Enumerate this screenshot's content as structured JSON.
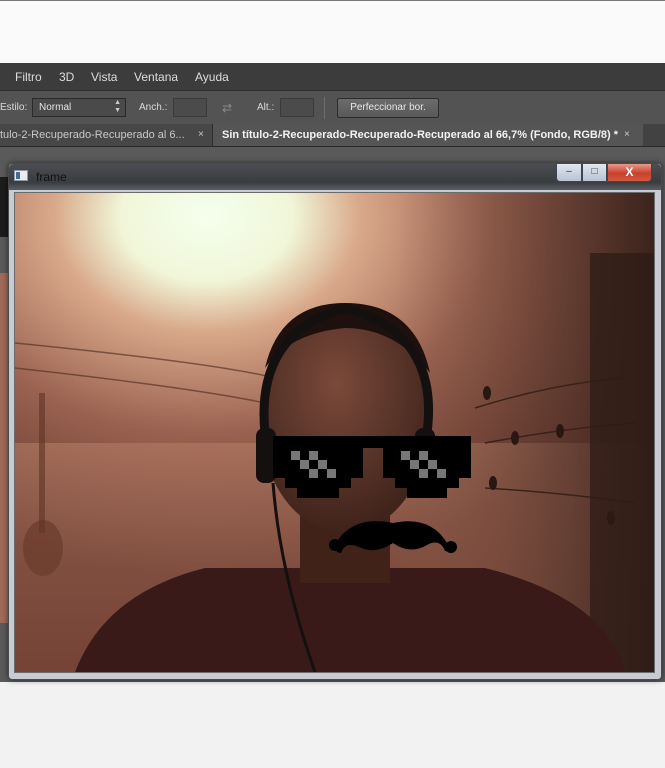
{
  "menu": {
    "items": [
      "Filtro",
      "3D",
      "Vista",
      "Ventana",
      "Ayuda"
    ]
  },
  "options": {
    "estilo_label": "Estilo:",
    "estilo_value": "Normal",
    "anch_label": "Anch.:",
    "alt_label": "Alt.:",
    "refine_button": "Perfeccionar bor."
  },
  "tabs": [
    {
      "label": "tulo-2-Recuperado-Recuperado al 6...",
      "close": "×"
    },
    {
      "label": "Sin título-2-Recuperado-Recuperado-Recuperado al 66,7% (Fondo, RGB/8) *",
      "close": "×"
    }
  ],
  "frame": {
    "title": "frame",
    "controls": {
      "minimize": "–",
      "maximize": "□",
      "close": "X"
    }
  },
  "colors": {
    "ps_dark": "#3c3c3c",
    "ps_mid": "#535353",
    "close_red": "#c7402a"
  }
}
